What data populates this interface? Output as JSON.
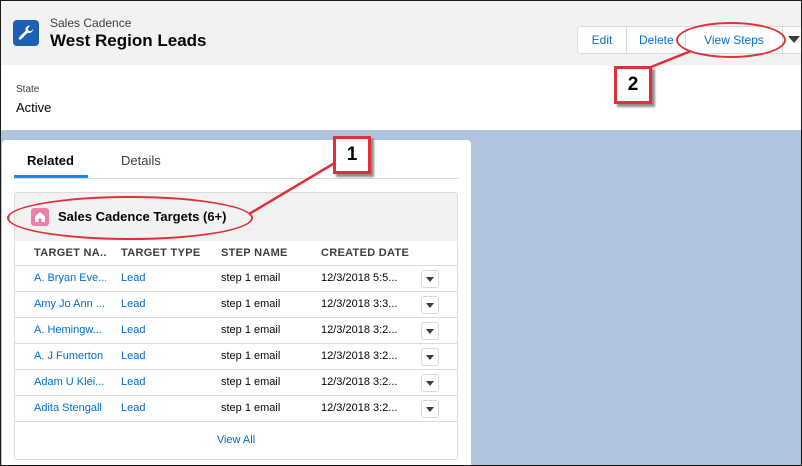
{
  "header": {
    "object_label": "Sales Cadence",
    "record_title": "West Region Leads",
    "icon": "wrench-icon",
    "actions": {
      "edit": "Edit",
      "delete": "Delete",
      "view_steps": "View Steps",
      "more_icon": "chevron-down-icon"
    }
  },
  "state": {
    "label": "State",
    "value": "Active"
  },
  "tabs": {
    "related": "Related",
    "details": "Details",
    "active": "Related"
  },
  "related_list": {
    "icon": "home-icon",
    "title": "Sales Cadence Targets (6+)",
    "columns": [
      "TARGET NA...",
      "TARGET TYPE",
      "STEP NAME",
      "CREATED DATE"
    ],
    "rows": [
      [
        "A. Bryan Eve...",
        "Lead",
        "step 1 email",
        "12/3/2018 5:5..."
      ],
      [
        "Amy Jo Ann ...",
        "Lead",
        "step 1 email",
        "12/3/2018 3:3..."
      ],
      [
        "A. Hemingw...",
        "Lead",
        "step 1 email",
        "12/3/2018 3:2..."
      ],
      [
        "A. J Fumerton",
        "Lead",
        "step 1 email",
        "12/3/2018 3:2..."
      ],
      [
        "Adam U Klei...",
        "Lead",
        "step 1 email",
        "12/3/2018 3:2..."
      ],
      [
        "Adita Stengall",
        "Lead",
        "step 1 email",
        "12/3/2018 3:2..."
      ]
    ],
    "view_all": "View All"
  },
  "callouts": {
    "one": "1",
    "two": "2"
  },
  "colors": {
    "brand": "#1b5fb6",
    "link": "#006dcc",
    "callout": "#e0303a",
    "background": "#b0c4df",
    "targets_icon": "#ef7ead"
  }
}
